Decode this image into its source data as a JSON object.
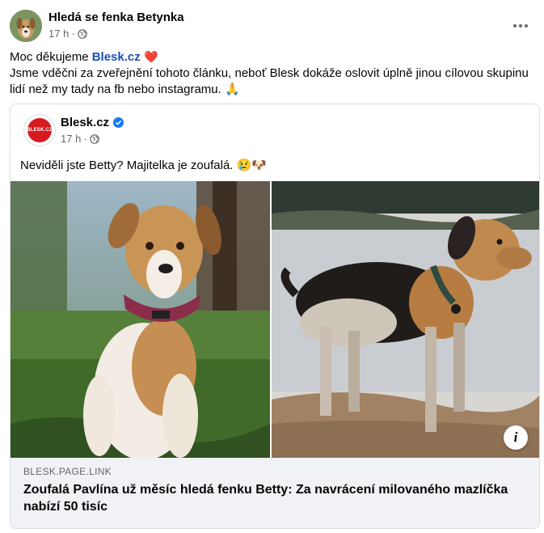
{
  "post": {
    "author": "Hledá se fenka Betynka",
    "time": "17 h",
    "separator": "·",
    "message_thanks": "Moc děkujeme",
    "message_link": "Blesk.cz",
    "message_body": "Jsme vděčni za zveřejnění tohoto článku, neboť Blesk dokáže oslovit úplně jinou cílovou skupinu lidí než my tady na fb nebo instagramu.",
    "heart_emoji": "❤️",
    "praying_emoji": "🙏"
  },
  "shared": {
    "page_name": "Blesk.cz",
    "logo_text": "BLESK.CZ",
    "time": "17 h",
    "separator": "·",
    "text": "Neviděli jste Betty? Majitelka je zoufalá.",
    "emojis": "😢🐶",
    "domain": "BLESK.PAGE.LINK",
    "headline": "Zoufalá Pavlína už měsíc hledá fenku Betty: Za navrácení milovaného mazlíčka nabízí 50 tisíc",
    "info_label": "i"
  },
  "icons": {
    "globe": "globe-icon",
    "more": "more-options-icon",
    "verified": "verified-badge-icon",
    "info": "info-icon"
  },
  "colors": {
    "link": "#1a4fb8",
    "meta_text": "#65676b",
    "card_border": "#dadde1",
    "footer_bg": "#f0f2f5",
    "brand_red": "#d71920",
    "verified_blue": "#1877f2"
  }
}
